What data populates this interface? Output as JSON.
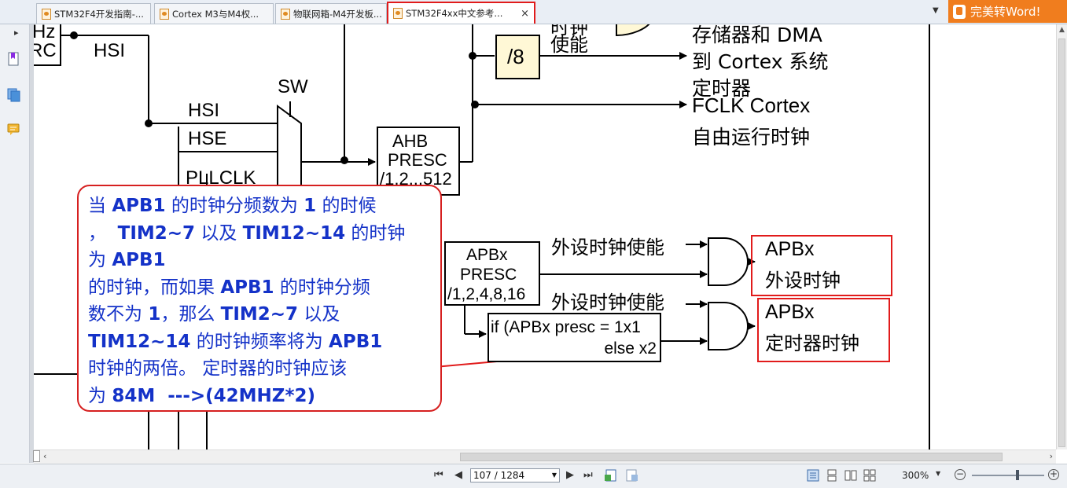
{
  "tabs": [
    {
      "label": "STM32F4开发指南-...",
      "active": false
    },
    {
      "label": "Cortex M3与M4权...",
      "active": false
    },
    {
      "label": "物联网箱-M4开发板...",
      "active": false
    },
    {
      "label": "STM32F4xx中文参考...",
      "active": true
    }
  ],
  "tab_close": "×",
  "tab_dropdown": "▼",
  "convert_button": "完美转Word!",
  "sidebar": {
    "collapse": "▸",
    "icons": [
      "bookmark-icon",
      "pages-icon",
      "comments-icon"
    ]
  },
  "diagram": {
    "hz_label": "Hz",
    "rc_label": "RC",
    "hsi_top": "HSI",
    "sw_label": "SW",
    "mux_inputs": [
      "HSI",
      "HSE",
      "PLLCLK"
    ],
    "clock_enable": "时钟",
    "clock_enable_2": "使能",
    "div8": "/8",
    "out1_line1": "存储器和 DMA",
    "out1_line2": "到 Cortex 系统",
    "out1_line3": "定时器",
    "fclk_line1": "FCLK Cortex",
    "fclk_line2": "自由运行时钟",
    "ahb": [
      "AHB",
      "PRESC",
      "/1,2...512"
    ],
    "apbx": [
      "APBx",
      "PRESC",
      "/1,2,4,8,16"
    ],
    "periph_enable_1": "外设时钟使能",
    "periph_enable_2": "外设时钟使能",
    "condition_line1": "if (APBx presc = 1x1",
    "condition_line2": "else x2",
    "out_apbx_periph": [
      "APBx",
      "外设时钟"
    ],
    "out_apbx_timer": [
      "APBx",
      "定时器时钟"
    ]
  },
  "callout": {
    "s1": "当 ",
    "b1": "APB1",
    "s2": " 的时钟分频数为 ",
    "b2": "1",
    "s3": " 的时候\n，  ",
    "b3": "TIM2~7",
    "s4": " 以及 ",
    "b4": "TIM12~14",
    "s5": " 的时钟\n为 ",
    "b5": "APB1",
    "s6": "\n的时钟，而如果 ",
    "b6": "APB1",
    "s7": " 的时钟分频\n数不为 ",
    "b7": "1",
    "s8": "，那么 ",
    "b8": "TIM2~7",
    "s9": " 以及\n",
    "b9": "TIM12~14",
    "s10": " 的时钟频率将为 ",
    "b10": "APB1",
    "s11": "\n时钟的两倍。 定时器的时钟应该\n为 ",
    "b11": "84M  --->(42MHZ*2)"
  },
  "statusbar": {
    "first": "⏮",
    "prev": "◀",
    "next": "▶",
    "last": "⏭",
    "page": "107 / 1284",
    "zoom": "300%",
    "zoom_out": "−",
    "zoom_in": "+"
  },
  "colors": {
    "accent_red": "#e11b1b",
    "callout_text": "#1432c8",
    "word_button": "#f07d1e",
    "box_fill": "#fff8d6"
  }
}
